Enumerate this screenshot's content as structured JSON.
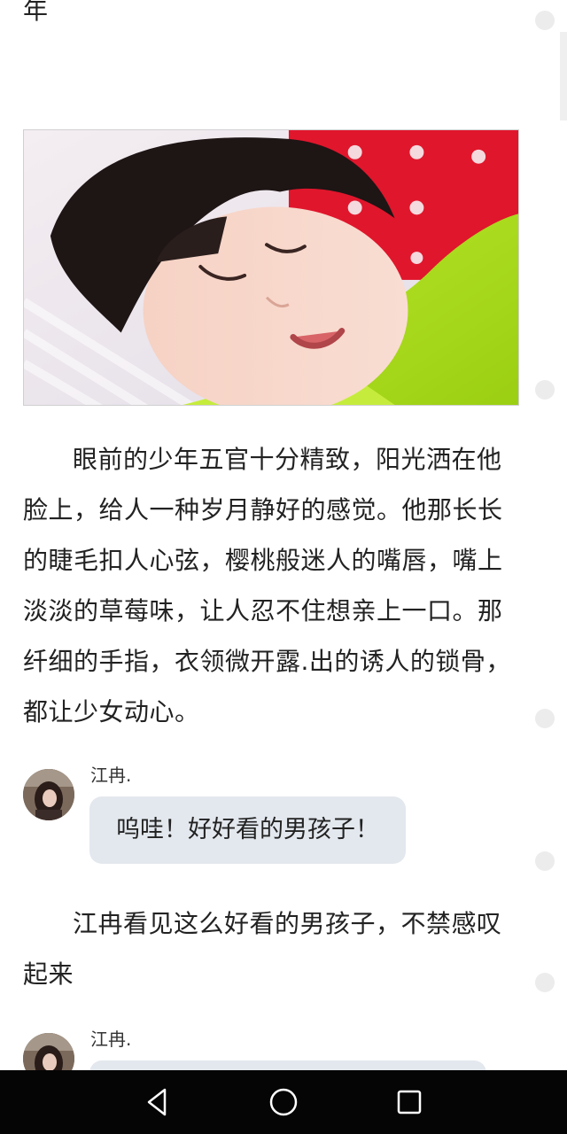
{
  "story": {
    "top_fragment": "年",
    "paragraph_1": "眼前的少年五官十分精致，阳光洒在他脸上，给人一种岁月静好的感觉。他那长长的睫毛扣人心弦，樱桃般迷人的嘴唇，嘴上淡淡的草莓味，让人忍不住想亲上一口。那纤细的手指，衣领微开露.出的诱人的锁骨，都让少女动心。",
    "paragraph_2": "江冉看见这么好看的男孩子，不禁感叹起来"
  },
  "image": {
    "icon": "photo-sleeping-boy"
  },
  "chat": [
    {
      "speaker": "江冉.",
      "message": "呜哇！好好看的男孩子！"
    },
    {
      "speaker": "江冉.",
      "message": ""
    }
  ],
  "navbar": {
    "back": "triangle-back-icon",
    "home": "circle-home-icon",
    "recents": "square-recents-icon"
  },
  "colors": {
    "bubble": "#e3e8ee",
    "navbar": "#050505",
    "text": "#222222"
  }
}
